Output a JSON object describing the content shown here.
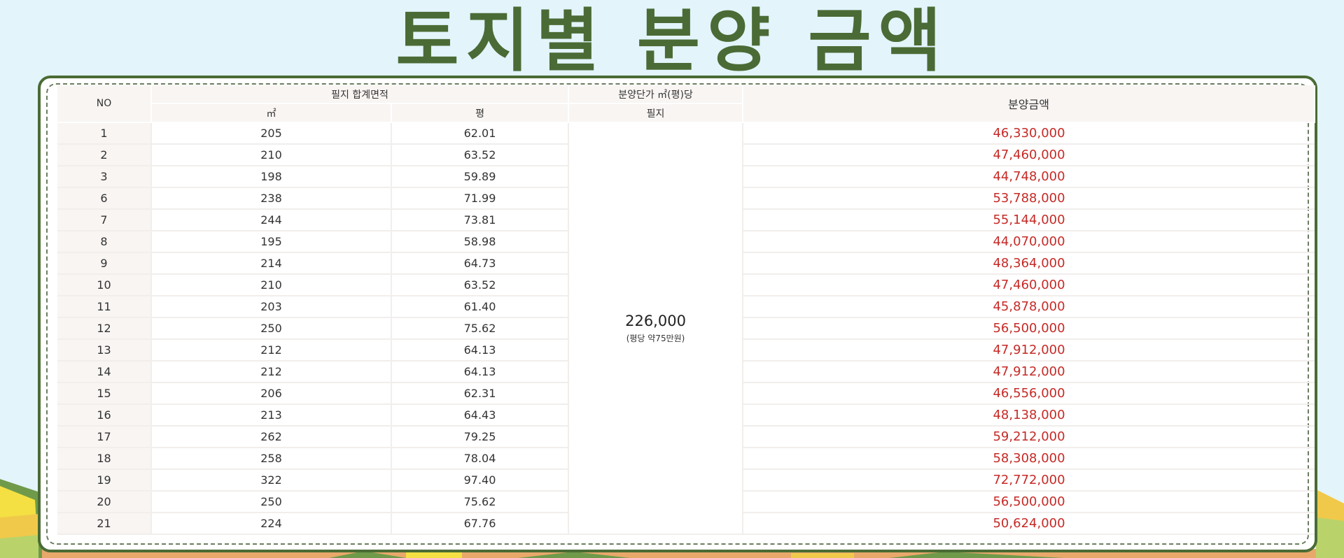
{
  "title": "토지별 분양 금액",
  "table": {
    "headers": {
      "no": "NO",
      "area_group": "필지 합계면적",
      "area_m2": "㎡",
      "area_pyeong": "평",
      "unit_price_group": "분양단가 ㎡(평)당",
      "unit_price_sub": "필지",
      "amount": "분양금액"
    },
    "unit_price": {
      "value": "226,000",
      "note": "(평당 약75만원)"
    },
    "rows": [
      {
        "no": "1",
        "m2": "205",
        "pyeong": "62.01",
        "amount": "46,330,000"
      },
      {
        "no": "2",
        "m2": "210",
        "pyeong": "63.52",
        "amount": "47,460,000"
      },
      {
        "no": "3",
        "m2": "198",
        "pyeong": "59.89",
        "amount": "44,748,000"
      },
      {
        "no": "6",
        "m2": "238",
        "pyeong": "71.99",
        "amount": "53,788,000"
      },
      {
        "no": "7",
        "m2": "244",
        "pyeong": "73.81",
        "amount": "55,144,000"
      },
      {
        "no": "8",
        "m2": "195",
        "pyeong": "58.98",
        "amount": "44,070,000"
      },
      {
        "no": "9",
        "m2": "214",
        "pyeong": "64.73",
        "amount": "48,364,000"
      },
      {
        "no": "10",
        "m2": "210",
        "pyeong": "63.52",
        "amount": "47,460,000"
      },
      {
        "no": "11",
        "m2": "203",
        "pyeong": "61.40",
        "amount": "45,878,000"
      },
      {
        "no": "12",
        "m2": "250",
        "pyeong": "75.62",
        "amount": "56,500,000"
      },
      {
        "no": "13",
        "m2": "212",
        "pyeong": "64.13",
        "amount": "47,912,000"
      },
      {
        "no": "14",
        "m2": "212",
        "pyeong": "64.13",
        "amount": "47,912,000"
      },
      {
        "no": "15",
        "m2": "206",
        "pyeong": "62.31",
        "amount": "46,556,000"
      },
      {
        "no": "16",
        "m2": "213",
        "pyeong": "64.43",
        "amount": "48,138,000"
      },
      {
        "no": "17",
        "m2": "262",
        "pyeong": "79.25",
        "amount": "59,212,000"
      },
      {
        "no": "18",
        "m2": "258",
        "pyeong": "78.04",
        "amount": "58,308,000"
      },
      {
        "no": "19",
        "m2": "322",
        "pyeong": "97.40",
        "amount": "72,772,000"
      },
      {
        "no": "20",
        "m2": "250",
        "pyeong": "75.62",
        "amount": "56,500,000"
      },
      {
        "no": "21",
        "m2": "224",
        "pyeong": "67.76",
        "amount": "50,624,000"
      }
    ]
  },
  "colors": {
    "title_green": "#4a6b35",
    "amount_red": "#c62a26",
    "header_bg": "#f8f5f3",
    "page_bg": "#e3f4fb"
  }
}
